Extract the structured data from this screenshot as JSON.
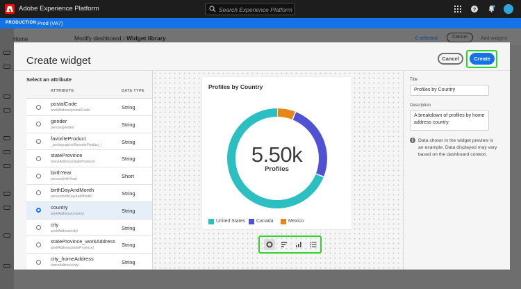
{
  "app": {
    "title": "Adobe Experience Platform",
    "search_placeholder": "Search Experience Platform",
    "icons": [
      "apps-grid-icon",
      "help-icon",
      "bell-icon",
      "avatar"
    ]
  },
  "env": {
    "label": "PRODUCTION",
    "sandbox": "Prod (VA7)"
  },
  "background": {
    "nav_home": "Home",
    "breadcrumb_parent": "Modify dashboard",
    "breadcrumb_current": "Widget library",
    "selected_count": "0 selected",
    "cancel": "Cancel",
    "add_widgets": "Add widgets"
  },
  "modal": {
    "title": "Create widget",
    "cancel_label": "Cancel",
    "create_label": "Create"
  },
  "attributes": {
    "heading": "Select an attribute",
    "col_attribute": "ATTRIBUTE",
    "col_type": "DATA TYPE",
    "rows": [
      {
        "name": "postalCode",
        "path": "workAddress/postalCode/",
        "type": "String",
        "selected": false
      },
      {
        "name": "gender",
        "path": "person/gender/",
        "type": "String",
        "selected": false
      },
      {
        "name": "favoriteProduct",
        "path": "_portingraproof/favoriteProduct_/",
        "type": "String",
        "selected": false
      },
      {
        "name": "stateProvince",
        "path": "homeAddress/stateProvince/",
        "type": "String",
        "selected": false
      },
      {
        "name": "birthYear",
        "path": "person/birthYear/",
        "type": "Short",
        "selected": false
      },
      {
        "name": "birthDayAndMonth",
        "path": "person/birthDayAndMonth/",
        "type": "String",
        "selected": false
      },
      {
        "name": "country",
        "path": "workAddress/country/",
        "type": "String",
        "selected": true
      },
      {
        "name": "city",
        "path": "workAddress/city/",
        "type": "String",
        "selected": false
      },
      {
        "name": "stateProvince_workAddress",
        "path": "workAddress/stateProvince/",
        "type": "String",
        "selected": false
      },
      {
        "name": "city_homeAddress",
        "path": "homeAddress/city/",
        "type": "String",
        "selected": false
      }
    ]
  },
  "widget": {
    "title": "Profiles by Country",
    "total": "5.50k",
    "total_label": "Profiles",
    "viz_icons": [
      "donut-chart-icon",
      "horizontal-bar-icon",
      "vertical-bar-icon",
      "list-icon"
    ]
  },
  "chart_data": {
    "type": "pie",
    "title": "Profiles by Country",
    "categories": [
      "United States",
      "Canada",
      "Mexico"
    ],
    "values": [
      69,
      25,
      6
    ],
    "colors": [
      "#2cbfc2",
      "#5151d3",
      "#e68619"
    ],
    "legend": "bottom"
  },
  "properties": {
    "title_label": "Title",
    "title_value": "Profiles by Country",
    "description_label": "Description",
    "description_value": "A breakdown of profiles by home address country.",
    "info": "Data shown in the widget preview is an example. Data displayed may vary based on the dashboard context."
  }
}
